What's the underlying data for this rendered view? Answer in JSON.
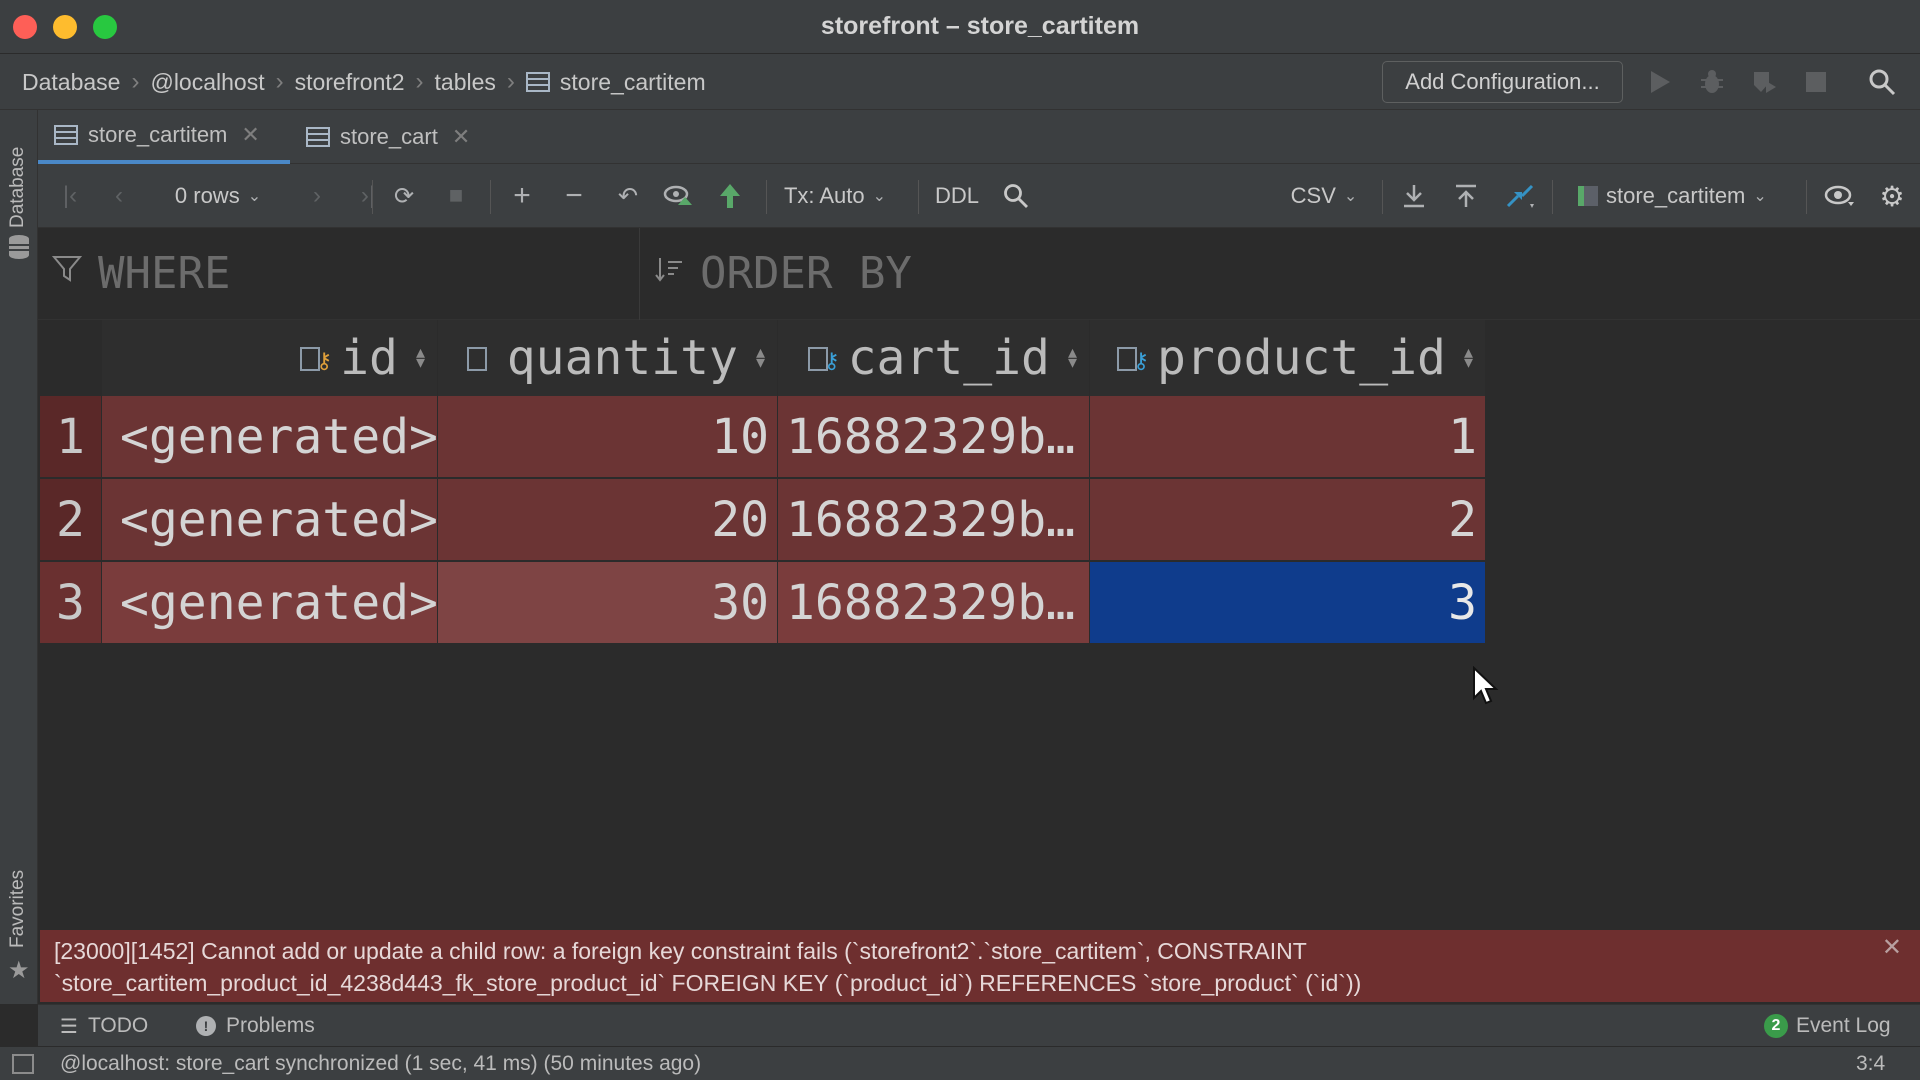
{
  "window": {
    "title": "storefront – store_cartitem"
  },
  "navbar": {
    "breadcrumbs": [
      "Database",
      "@localhost",
      "storefront2",
      "tables",
      "store_cartitem"
    ],
    "add_configuration_label": "Add Configuration...",
    "icons": [
      "run-icon",
      "debug-icon",
      "coverage-icon",
      "stop-icon",
      "search-icon"
    ]
  },
  "side": {
    "top_label": "Database",
    "bottom_label": "Favorites"
  },
  "tabs": [
    {
      "label": "store_cartitem",
      "active": true
    },
    {
      "label": "store_cart",
      "active": false
    }
  ],
  "toolbar": {
    "rows_label": "0 rows",
    "tx_label": "Tx: Auto",
    "ddl_label": "DDL",
    "export_format": "CSV",
    "table_selector": "store_cartitem"
  },
  "filter": {
    "where_placeholder": "WHERE",
    "order_by_placeholder": "ORDER BY"
  },
  "grid": {
    "columns": [
      {
        "name": "id",
        "key": "primary"
      },
      {
        "name": "quantity",
        "key": "none"
      },
      {
        "name": "cart_id",
        "key": "foreign"
      },
      {
        "name": "product_id",
        "key": "foreign"
      }
    ],
    "rows": [
      {
        "num": "1",
        "id": "<generated>",
        "quantity": "10",
        "cart_id": "16882329b…",
        "product_id": "1"
      },
      {
        "num": "2",
        "id": "<generated>",
        "quantity": "20",
        "cart_id": "16882329b…",
        "product_id": "2"
      },
      {
        "num": "3",
        "id": "<generated>",
        "quantity": "30",
        "cart_id": "16882329b…",
        "product_id": "3"
      }
    ],
    "selected_cell": {
      "row": 3,
      "column": "product_id"
    }
  },
  "error": {
    "line1": "[23000][1452] Cannot add or update a child row: a foreign key constraint fails (`storefront2`.`store_cartitem`, CONSTRAINT",
    "line2": "`store_cartitem_product_id_4238d443_fk_store_product_id` FOREIGN KEY (`product_id`) REFERENCES `store_product` (`id`))"
  },
  "toolwindows": {
    "todo": "TODO",
    "problems": "Problems",
    "event_log_count": "2",
    "event_log": "Event Log"
  },
  "status": {
    "message": "@localhost: store_cart synchronized (1 sec, 41 ms) (50 minutes ago)",
    "position": "3:4"
  },
  "colors": {
    "row_modified": "#6b3434",
    "row_number_bg": "#5a2828",
    "selected_cell": "#0f3c8c",
    "error_bg": "#6e2f2f",
    "accent": "#4a88c7"
  }
}
